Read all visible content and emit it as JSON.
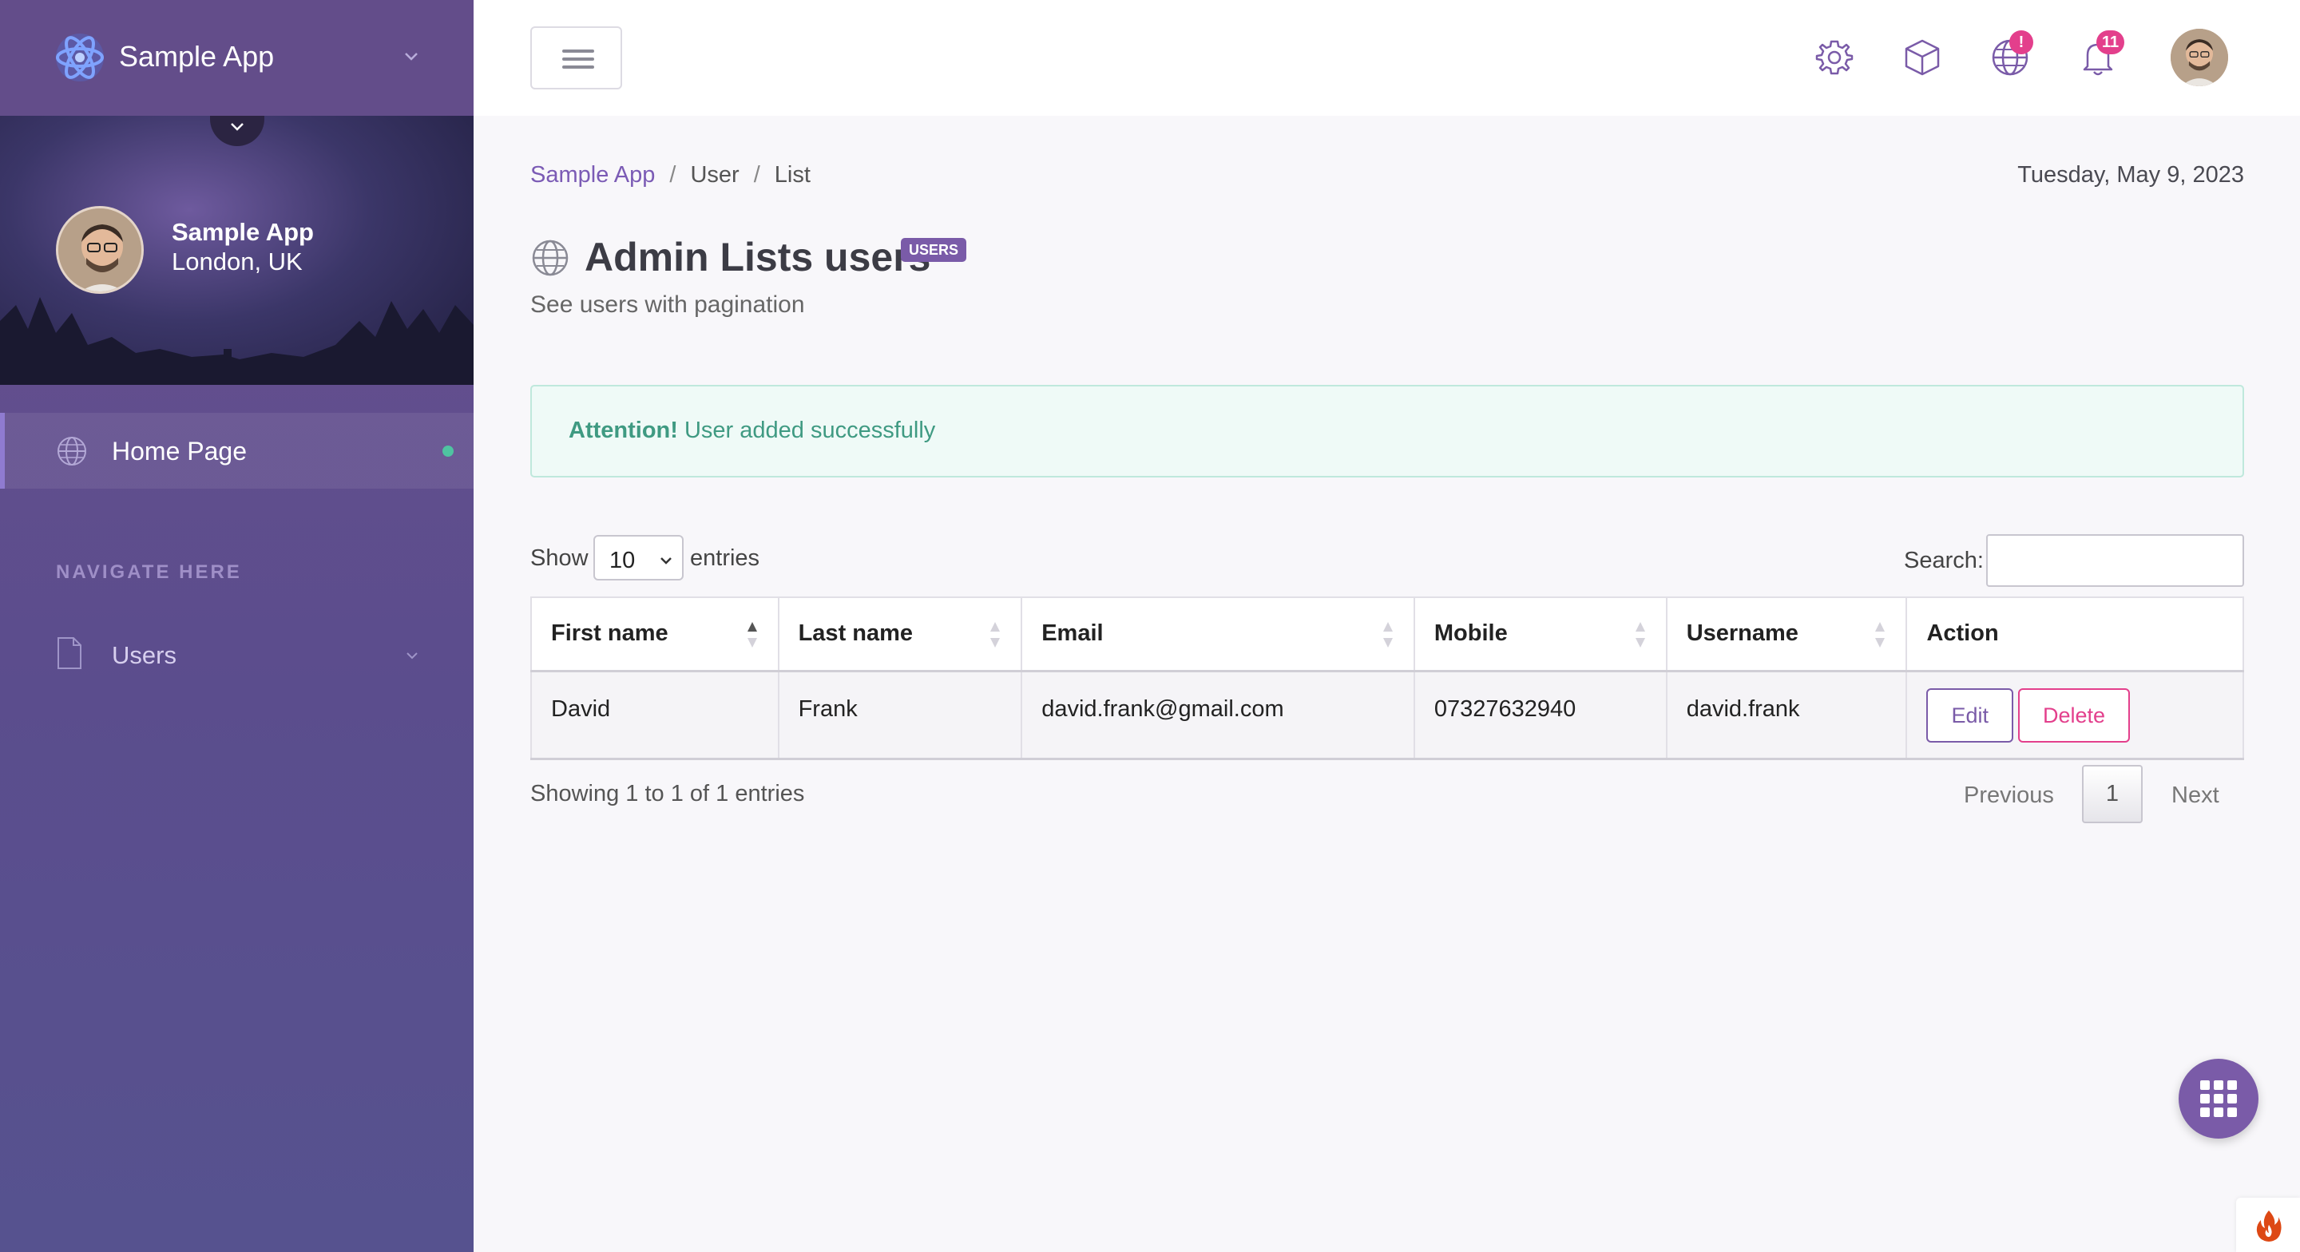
{
  "app": {
    "name": "Sample App"
  },
  "profile": {
    "name": "Sample App",
    "location": "London, UK"
  },
  "sidebar": {
    "home_label": "Home Page",
    "section_label": "NAVIGATE HERE",
    "users_label": "Users"
  },
  "header": {
    "globe_badge": "!",
    "notifications_badge": "11"
  },
  "breadcrumb": {
    "root": "Sample App",
    "level1": "User",
    "level2": "List"
  },
  "date": "Tuesday, May 9, 2023",
  "page": {
    "title_strong": "Admin",
    "title_rest": "Lists users",
    "badge": "USERS",
    "subtitle": "See users with pagination"
  },
  "alert": {
    "strong": "Attention!",
    "message": "User added successfully"
  },
  "table_controls": {
    "show_label": "Show",
    "page_size": "10",
    "entries_label": "entries",
    "search_label": "Search:",
    "search_value": ""
  },
  "table": {
    "headers": [
      "First name",
      "Last name",
      "Email",
      "Mobile",
      "Username",
      "Action"
    ],
    "rows": [
      {
        "first": "David",
        "last": "Frank",
        "email": "david.frank@gmail.com",
        "mobile": "07327632940",
        "username": "david.frank"
      }
    ],
    "edit_label": "Edit",
    "delete_label": "Delete"
  },
  "pagination": {
    "info": "Showing 1 to 1 of 1 entries",
    "previous": "Previous",
    "current": "1",
    "next": "Next"
  },
  "colors": {
    "accent": "#7a5ba8",
    "danger": "#e33f8c",
    "success": "#3f9a82",
    "sidebar": "#5b4d8d"
  },
  "icons": {
    "brand": "atom-logo-icon",
    "settings": "gear-icon",
    "apps": "cube-icon",
    "language": "globe-icon",
    "notifications": "bell-icon",
    "fab": "grid-icon",
    "corner": "flame-icon"
  }
}
